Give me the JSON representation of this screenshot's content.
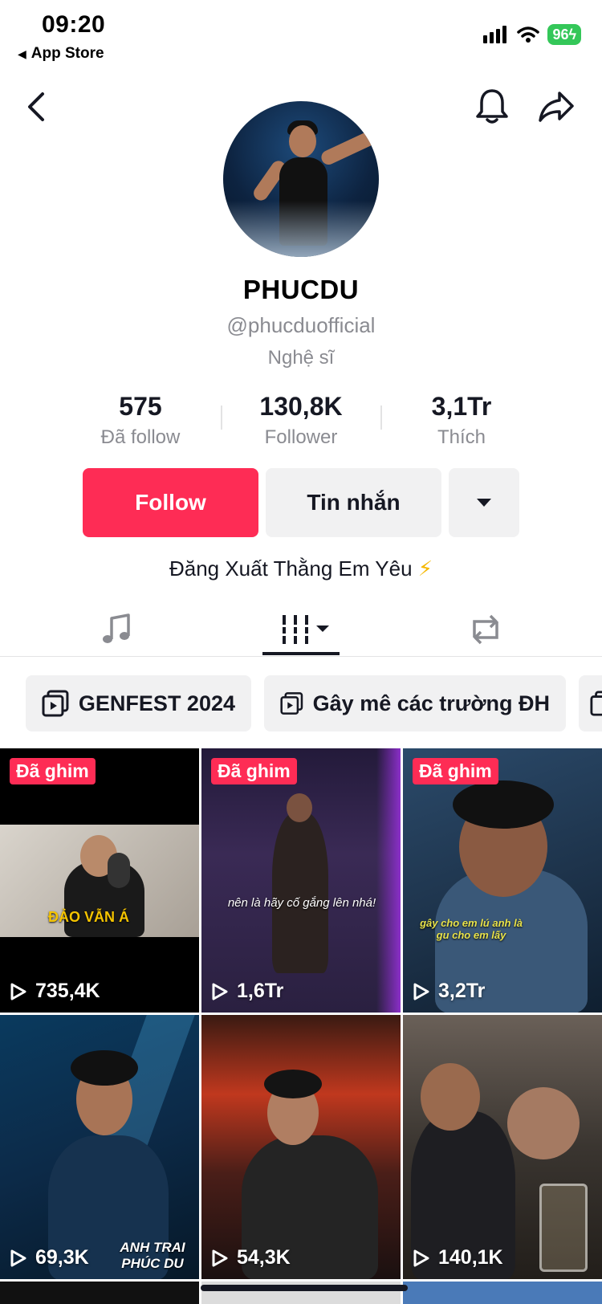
{
  "status_bar": {
    "time": "09:20",
    "back_app": "App Store",
    "battery": "96"
  },
  "profile": {
    "name": "PHUCDU",
    "handle": "@phucduofficial",
    "category": "Nghệ sĩ",
    "bio": "Đăng Xuất Thằng Em Yêu",
    "bio_emoji": "⚡"
  },
  "stats": [
    {
      "value": "575",
      "label": "Đã follow"
    },
    {
      "value": "130,8K",
      "label": "Follower"
    },
    {
      "value": "3,1Tr",
      "label": "Thích"
    }
  ],
  "actions": {
    "follow": "Follow",
    "message": "Tin nhắn"
  },
  "tabs": [
    "music-tab",
    "videos-tab",
    "reposts-tab"
  ],
  "playlists": [
    {
      "label": "GENFEST 2024"
    },
    {
      "label": "Gây mê các trường ĐH"
    }
  ],
  "videos": [
    {
      "pinned": "Đã ghim",
      "views": "735,4K",
      "caption": "ĐẢO VẪN Á"
    },
    {
      "pinned": "Đã ghim",
      "views": "1,6Tr",
      "caption": "nên là hãy cố gắng lên nhá!"
    },
    {
      "pinned": "Đã ghim",
      "views": "3,2Tr",
      "caption": "gây cho em lú anh là gu cho em lấy"
    },
    {
      "views": "69,3K",
      "caption": "ANH TRAI PHÚC DU"
    },
    {
      "views": "54,3K"
    },
    {
      "views": "140,1K"
    }
  ],
  "colors": {
    "accent": "#fe2c55",
    "text": "#161823",
    "muted": "#8a8b91",
    "chip_bg": "#f1f1f2"
  }
}
